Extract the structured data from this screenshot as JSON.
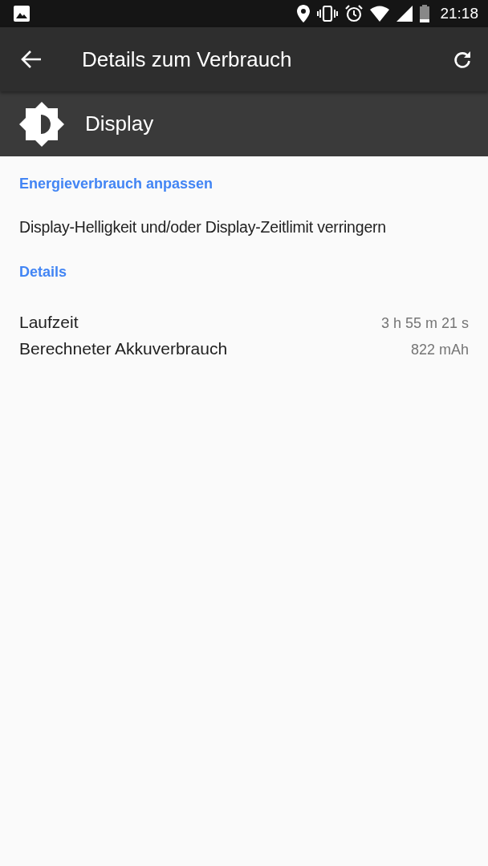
{
  "status_bar": {
    "time": "21:18"
  },
  "toolbar": {
    "title": "Details zum Verbrauch"
  },
  "header": {
    "title": "Display"
  },
  "sections": [
    {
      "kind": "action",
      "title": "Energieverbrauch anpassen",
      "text": "Display-Helligkeit und/oder Display-Zeitlimit verringern"
    },
    {
      "kind": "details",
      "title": "Details",
      "rows": [
        {
          "label": "Laufzeit",
          "value": "3 h 55 m 21 s"
        },
        {
          "label": "Berechneter Akkuverbrauch",
          "value": "822 mAh"
        }
      ]
    }
  ]
}
